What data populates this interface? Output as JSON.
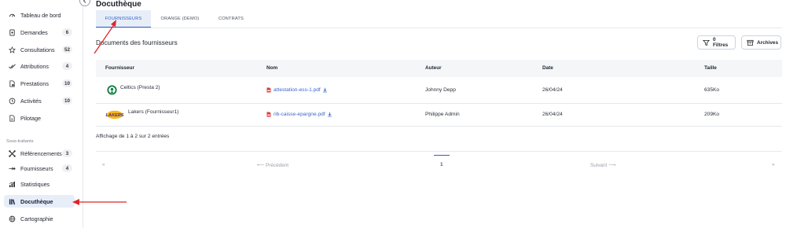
{
  "app": {
    "page_title": "Docuthèque"
  },
  "sidebar": {
    "items": [
      {
        "label": "Tableau de bord",
        "icon": "dashboard-gauge-icon",
        "badge": null
      },
      {
        "label": "Demandes",
        "icon": "document-request-icon",
        "badge": "6"
      },
      {
        "label": "Consultations",
        "icon": "star-icon",
        "badge": "52"
      },
      {
        "label": "Attributions",
        "icon": "checks-icon",
        "badge": "4"
      },
      {
        "label": "Prestations",
        "icon": "service-file-icon",
        "badge": "10"
      },
      {
        "label": "Activités",
        "icon": "clock-icon",
        "badge": "10"
      },
      {
        "label": "Pilotage",
        "icon": "pilot-document-icon",
        "badge": null
      },
      {
        "label": "Référencements",
        "icon": "network-icon",
        "badge": "3"
      },
      {
        "label": "Fournisseurs",
        "icon": "supplier-link-icon",
        "badge": "4"
      },
      {
        "label": "Statistiques",
        "icon": "bar-chart-icon",
        "badge": null
      },
      {
        "label": "Docuthèque",
        "icon": "library-books-icon",
        "badge": null
      },
      {
        "label": "Cartographie",
        "icon": "globe-icon",
        "badge": null
      }
    ],
    "section_label": "Sous-traitants"
  },
  "tabs": [
    {
      "label": "FOURNISSEURS",
      "active": true
    },
    {
      "label": "ORANGE (DEMO)",
      "active": false
    },
    {
      "label": "CONTRATS",
      "active": false
    }
  ],
  "section": {
    "title": "Documents des fournisseurs",
    "filters_label": "0 Filtres",
    "archives_label": "Archives"
  },
  "table": {
    "columns": [
      "Fournisseur",
      "Nom",
      "Auteur",
      "Date",
      "Taille"
    ],
    "rows": [
      {
        "supplier": "Celtics (Presta 2)",
        "logo": "celtics-logo",
        "file": "attestation-ess-1.pdf",
        "author": "Johnny Depp",
        "date": "26/04/24",
        "size": "635Ko"
      },
      {
        "supplier": "Lakers (Fournisseur1)",
        "logo": "lakers-logo",
        "logo_text": "LAKERS",
        "file": "rib-caisse-epargne.pdf",
        "author": "Philippe Admin",
        "date": "26/04/24",
        "size": "209Ko"
      }
    ]
  },
  "pagination": {
    "summary": "Affichage de 1 à 2 sur 2 entrées",
    "first": "«",
    "prev": "Précédent",
    "current": "1",
    "next": "Suivant",
    "last": "»"
  },
  "colors": {
    "accent": "#2f5fc4",
    "annotation_arrow": "#d9262b",
    "active_bg": "#e8eef8"
  }
}
